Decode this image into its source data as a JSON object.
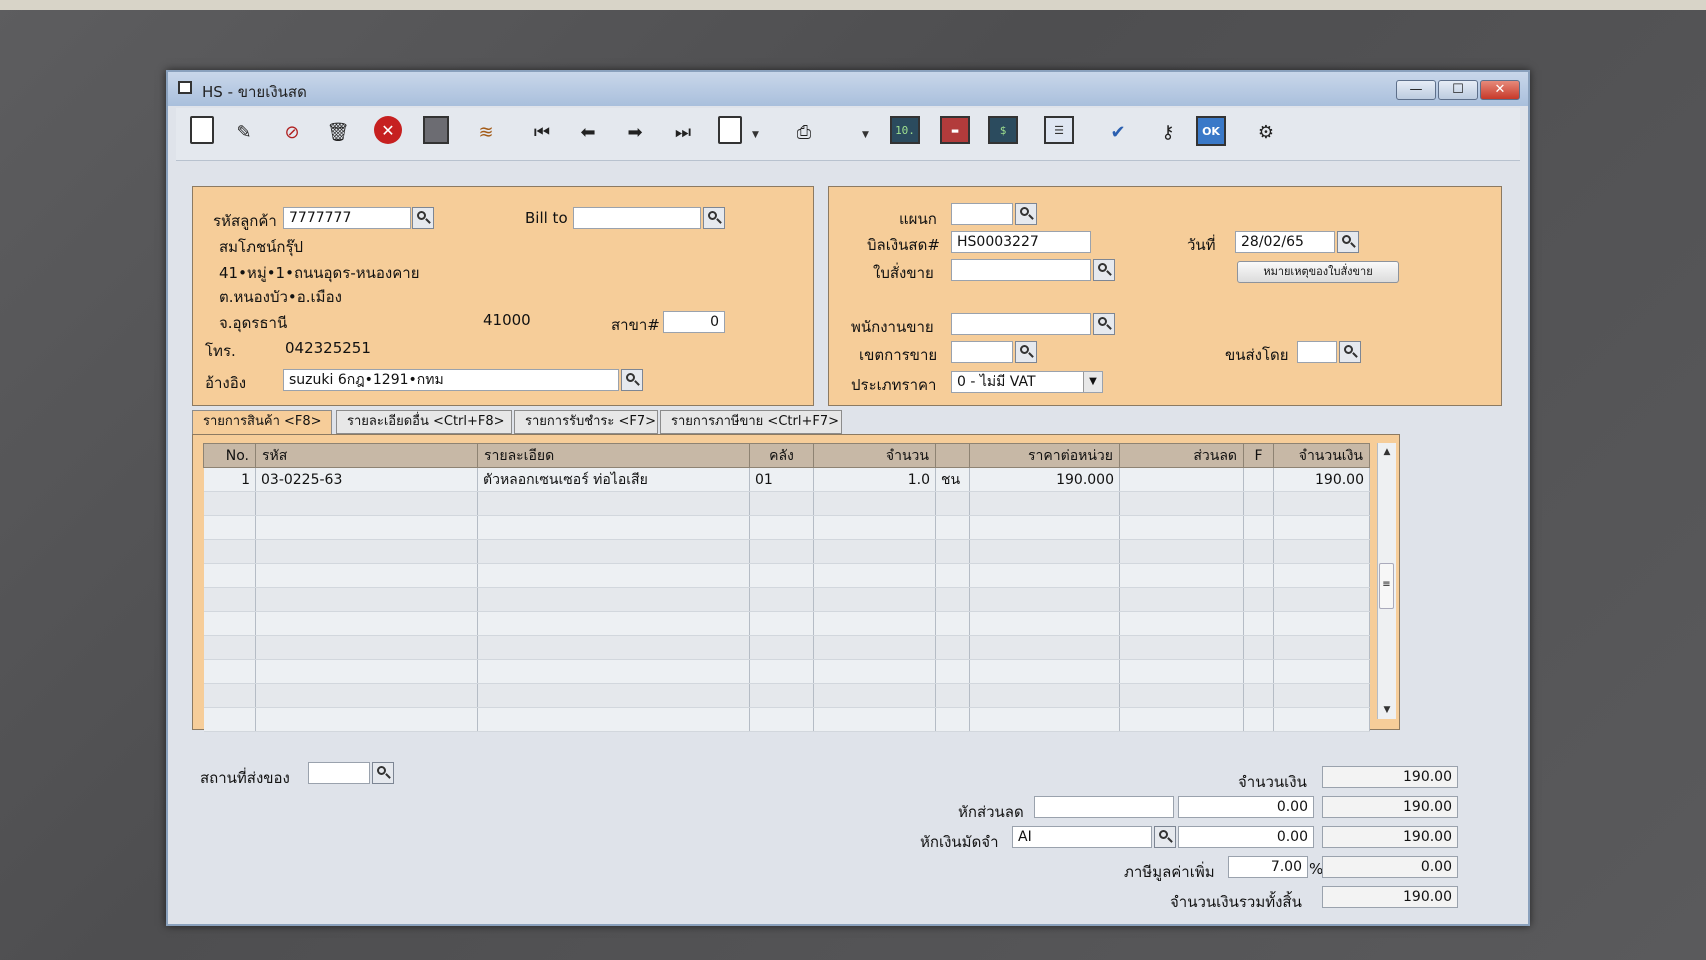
{
  "window": {
    "title": "HS - ขายเงินสด",
    "minimize": "—",
    "maximize": "☐",
    "close": "✕"
  },
  "toolbar": {
    "icons": [
      "new-icon",
      "edit-icon",
      "cancel-doc-icon",
      "delete-icon",
      "close-red-icon",
      "save-icon",
      "books-icon",
      "first-icon",
      "prev-icon",
      "next-icon",
      "last-icon",
      "preview-icon",
      "print-icon",
      "calculator-icon",
      "card-icon",
      "dollar-icon",
      "report-icon",
      "approve-icon",
      "key-icon",
      "ok-icon",
      "tools-icon"
    ]
  },
  "customer": {
    "code_label": "รหัสลูกค้า",
    "code": "7777777",
    "bill_to_label": "Bill to",
    "bill_to": "",
    "name": "สมโภชน์กรุ๊ป",
    "address1": "41•หมู่•1•ถนนอุดร-หนองคาย",
    "address2": "ต.หนองบัว•อ.เมือง",
    "province": "จ.อุดรธานี",
    "postcode": "41000",
    "branch_label": "สาขา#",
    "branch": "0",
    "phone_label": "โทร.",
    "phone": "042325251",
    "ref_label": "อ้างอิง",
    "ref": "suzuki 6กฎ•1291•กทม"
  },
  "doc": {
    "dept_label": "แผนก",
    "dept": "",
    "bill_label": "บิลเงินสด#",
    "bill": "HS0003227",
    "date_label": "วันที่",
    "date": "28/02/65",
    "so_label": "ใบสั่งขาย",
    "so": "",
    "so_note_button": "หมายเหตุของใบสั่งขาย",
    "salesman_label": "พนักงานขาย",
    "salesman": "",
    "area_label": "เขตการขาย",
    "area": "",
    "ship_by_label": "ขนส่งโดย",
    "ship_by": "",
    "price_type_label": "ประเภทราคา",
    "price_type": "0 - ไม่มี VAT"
  },
  "tabs": [
    {
      "label": "รายการสินค้า <F8>"
    },
    {
      "label": "รายละเอียดอื่น <Ctrl+F8>"
    },
    {
      "label": "รายการรับชำระ <F7>"
    },
    {
      "label": "รายการภาษีขาย <Ctrl+F7>"
    }
  ],
  "grid": {
    "headers": [
      "No.",
      "รหัส",
      "รายละเอียด",
      "คลัง",
      "จำนวน",
      "",
      "ราคาต่อหน่วย",
      "ส่วนลด",
      "F",
      "จำนวนเงิน"
    ],
    "rows": [
      [
        "1",
        "03-0225-63",
        "ตัวหลอกเซนเซอร์ ท่อไอเสีย",
        "01",
        "1.0",
        "ชน",
        "190.000",
        "",
        "",
        "190.00"
      ]
    ]
  },
  "footer": {
    "ship_place_label": "สถานที่ส่งของ",
    "ship_place": "",
    "amount_label": "จำนวนเงิน",
    "amount": "190.00",
    "discount_label": "หักส่วนลด",
    "discount_text": "",
    "discount_value": "0.00",
    "discount_total": "190.00",
    "deposit_label": "หักเงินมัดจำ",
    "deposit_code": "AI",
    "deposit_value": "0.00",
    "deposit_total": "190.00",
    "vat_label": "ภาษีมูลค่าเพิ่ม",
    "vat_rate": "7.00",
    "vat_pct": "%",
    "vat_amount": "0.00",
    "grand_label": "จำนวนเงินรวมทั้งสิ้น",
    "grand_total": "190.00"
  }
}
